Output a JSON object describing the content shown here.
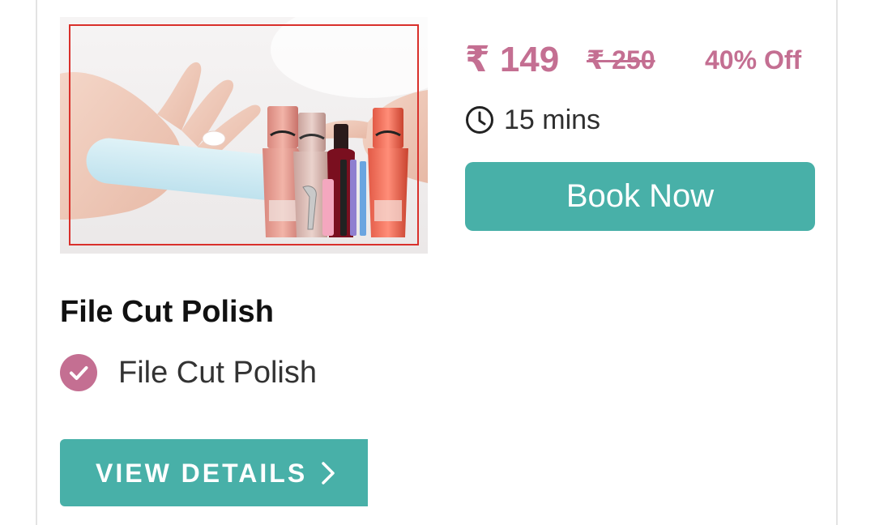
{
  "service": {
    "title": "File Cut Polish",
    "price": {
      "current": "₹ 149",
      "original": "₹ 250",
      "discount": "40% Off"
    },
    "duration": "15 mins",
    "book_label": "Book Now",
    "inclusions": [
      {
        "label": "File Cut Polish"
      }
    ],
    "details_label": "VIEW DETAILS"
  },
  "icons": {
    "clock": "clock-icon",
    "check": "check-circle-icon",
    "chevron": "chevron-right-icon"
  },
  "colors": {
    "accent_pink": "#c46f92",
    "primary_teal": "#48b0a8",
    "text_dark": "#111111",
    "text_body": "#333333",
    "card_border": "#e3e3e3"
  }
}
